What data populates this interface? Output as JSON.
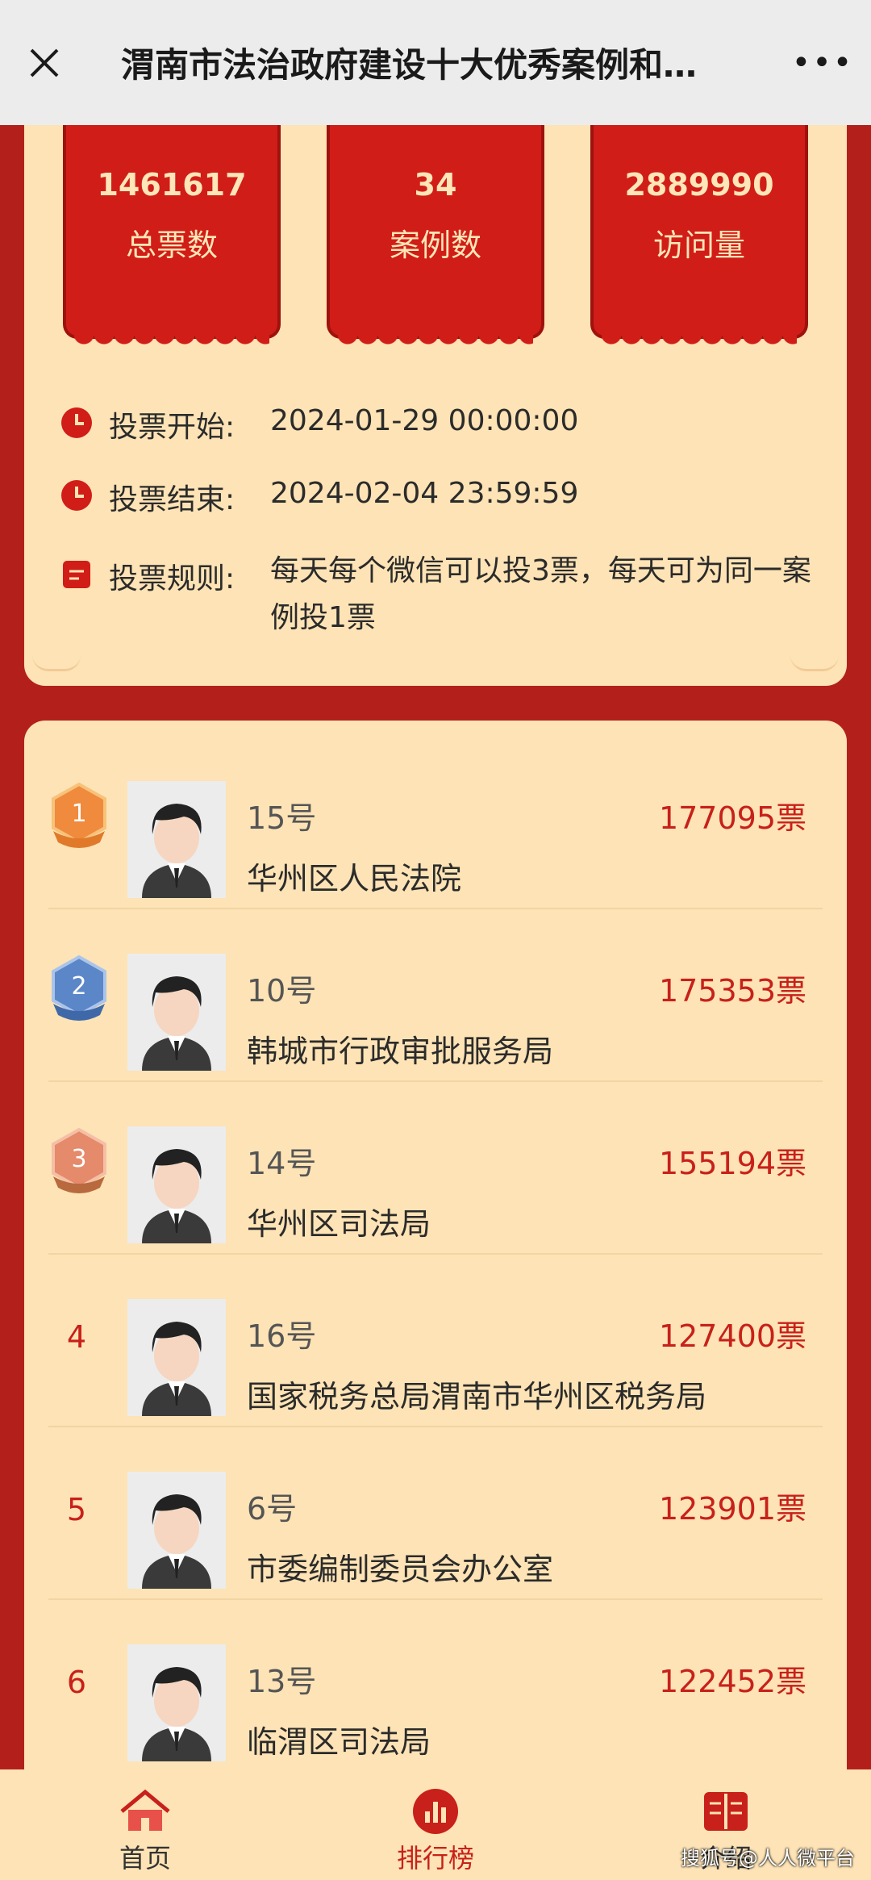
{
  "header": {
    "title": "渭南市法治政府建设十大优秀案例和…",
    "close_icon": "close-icon",
    "more_icon": "more-icon",
    "more_glyph": "•••"
  },
  "stats": [
    {
      "value": "1461617",
      "label": "总票数"
    },
    {
      "value": "34",
      "label": "案例数"
    },
    {
      "value": "2889990",
      "label": "访问量"
    }
  ],
  "info": {
    "start_label": "投票开始:",
    "start_value": "2024-01-29 00:00:00",
    "end_label": "投票结束:",
    "end_value": "2024-02-04 23:59:59",
    "rule_label": "投票规则:",
    "rule_value": "每天每个微信可以投3票，每天可为同一案例投1票"
  },
  "ranking": [
    {
      "rank": "1",
      "number": "15号",
      "votes": "177095票",
      "org": "华州区人民法院",
      "medal": "gold"
    },
    {
      "rank": "2",
      "number": "10号",
      "votes": "175353票",
      "org": "韩城市行政审批服务局",
      "medal": "silver"
    },
    {
      "rank": "3",
      "number": "14号",
      "votes": "155194票",
      "org": "华州区司法局",
      "medal": "bronze"
    },
    {
      "rank": "4",
      "number": "16号",
      "votes": "127400票",
      "org": "国家税务总局渭南市华州区税务局",
      "medal": ""
    },
    {
      "rank": "5",
      "number": "6号",
      "votes": "123901票",
      "org": "市委编制委员会办公室",
      "medal": ""
    },
    {
      "rank": "6",
      "number": "13号",
      "votes": "122452票",
      "org": "临渭区司法局",
      "medal": ""
    }
  ],
  "tabs": {
    "home": "首页",
    "ranking": "排行榜",
    "intro": "介绍"
  },
  "watermark": "搜狐号@人人微平台",
  "colors": {
    "brand_red": "#b3201c",
    "card_bg": "#fde3b5",
    "accent_red": "#c8201a"
  }
}
